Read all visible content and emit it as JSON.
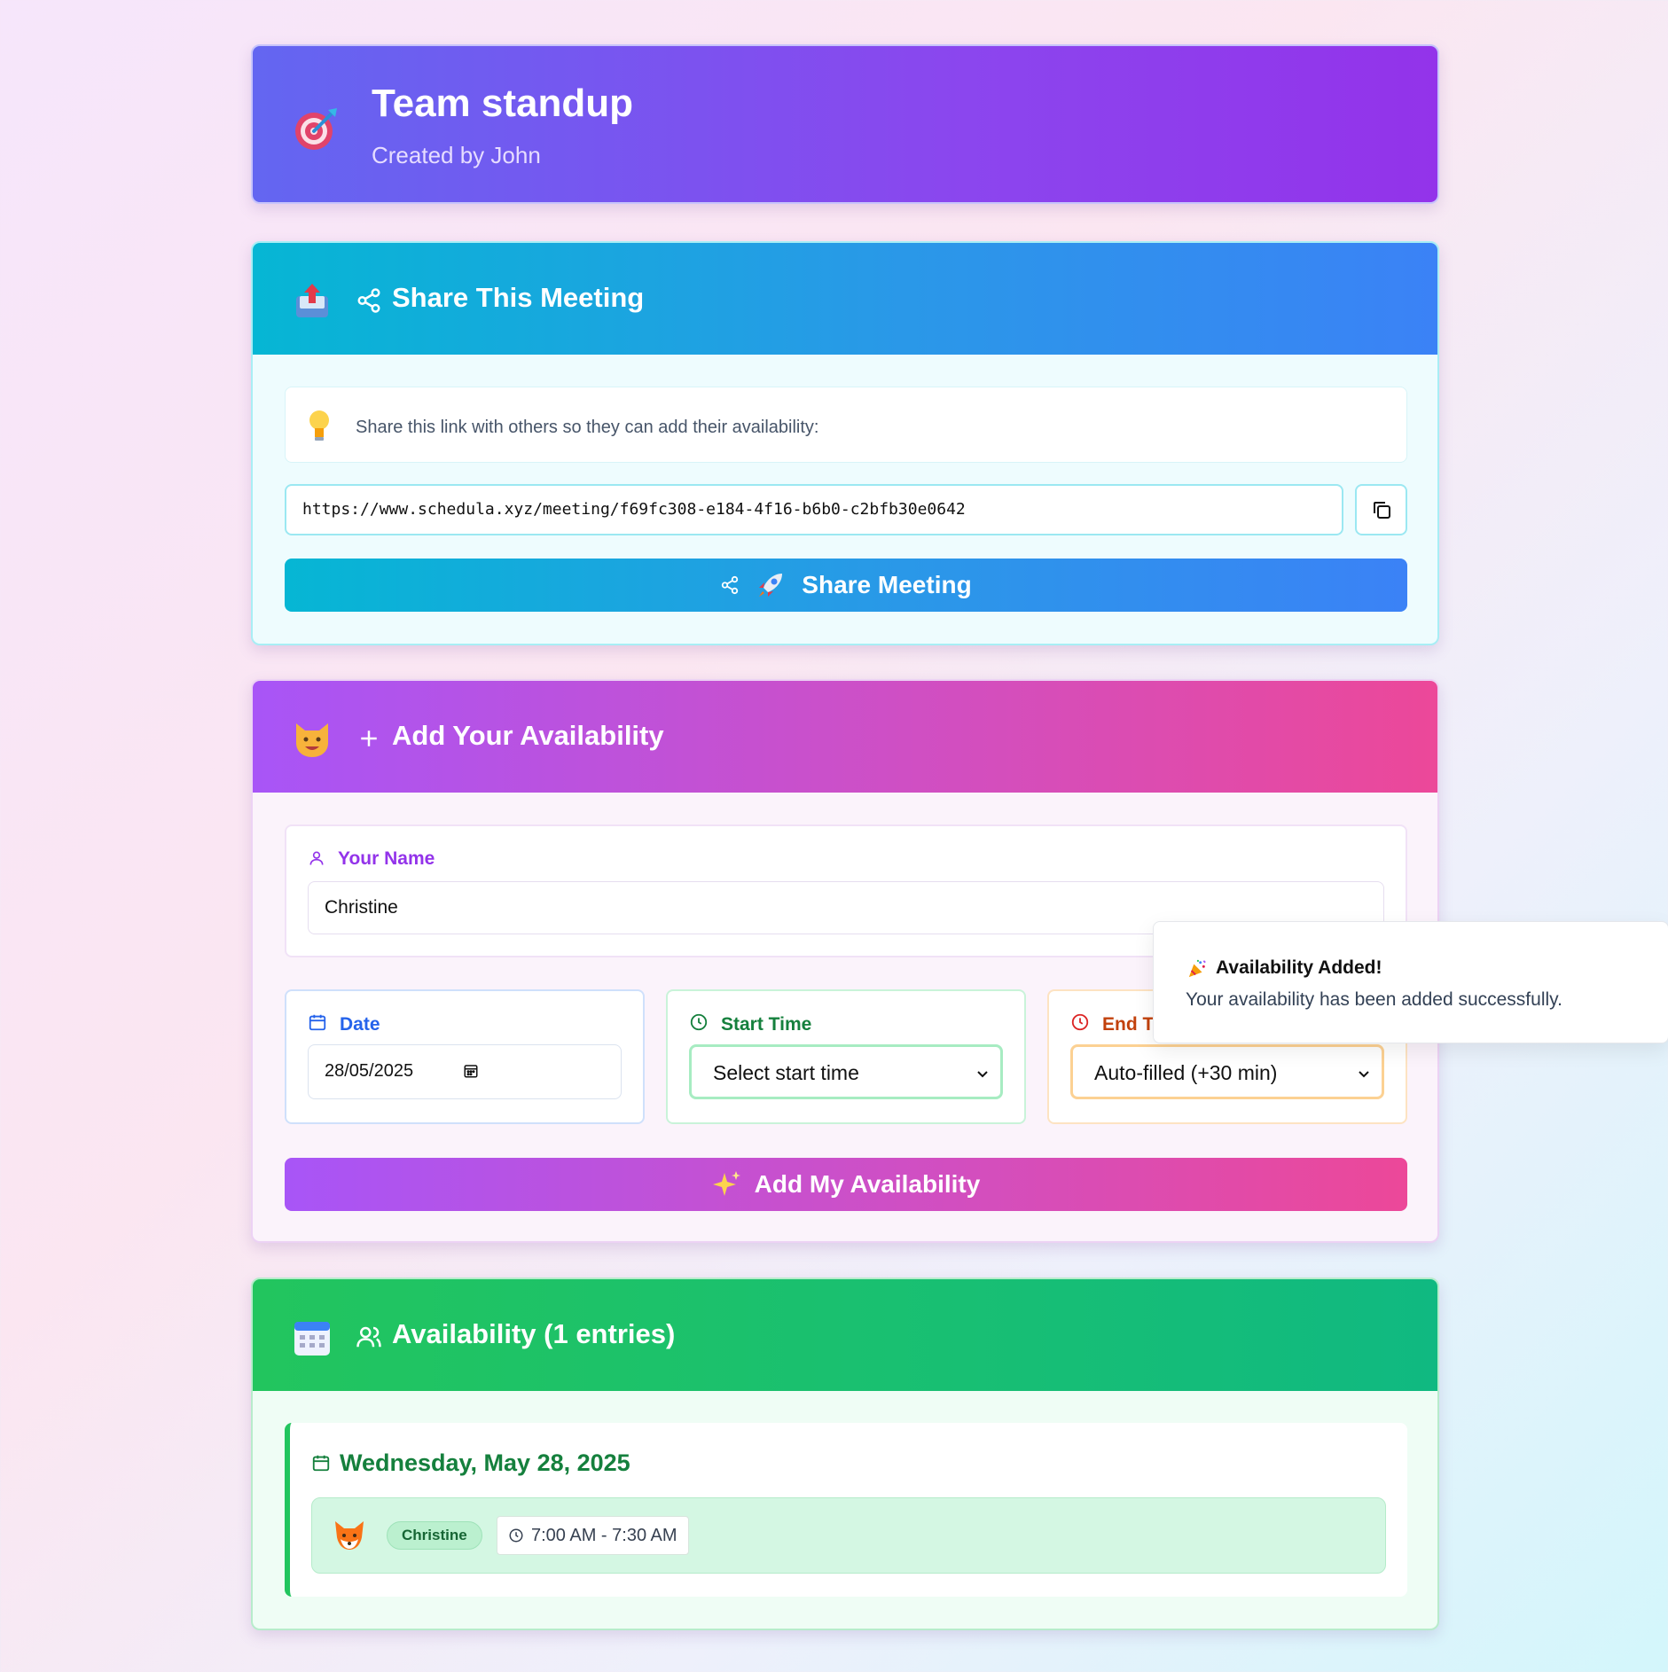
{
  "header": {
    "title": "Team standup",
    "subtitle": "Created by John",
    "icon": "target-emoji"
  },
  "share": {
    "title": "Share This Meeting",
    "tip": "Share this link with others so they can add their availability:",
    "link": "https://www.schedula.xyz/meeting/f69fc308-e184-4f16-b6b0-c2bfb30e0642",
    "button_label": "Share Meeting"
  },
  "add": {
    "title": "Add Your Availability",
    "name_label": "Your Name",
    "name_value": "Christine",
    "date_label": "Date",
    "date_value": "28/05/2025",
    "start_label": "Start Time",
    "start_value": "Select start time",
    "end_label": "End Ti",
    "end_value": "Auto-filled (+30 min)",
    "button_label": "Add My Availability"
  },
  "toast": {
    "title": "Availability Added!",
    "message": "Your availability has been added successfully."
  },
  "availability": {
    "title": "Availability (1 entries)",
    "groups": [
      {
        "date": "Wednesday, May 28, 2025",
        "entries": [
          {
            "name": "Christine",
            "time": "7:00 AM - 7:30 AM"
          }
        ]
      }
    ]
  },
  "colors": {
    "header": "#8b46ee",
    "share": "#06b6d4",
    "add": "#cf4fc4",
    "list": "#22c55e"
  }
}
